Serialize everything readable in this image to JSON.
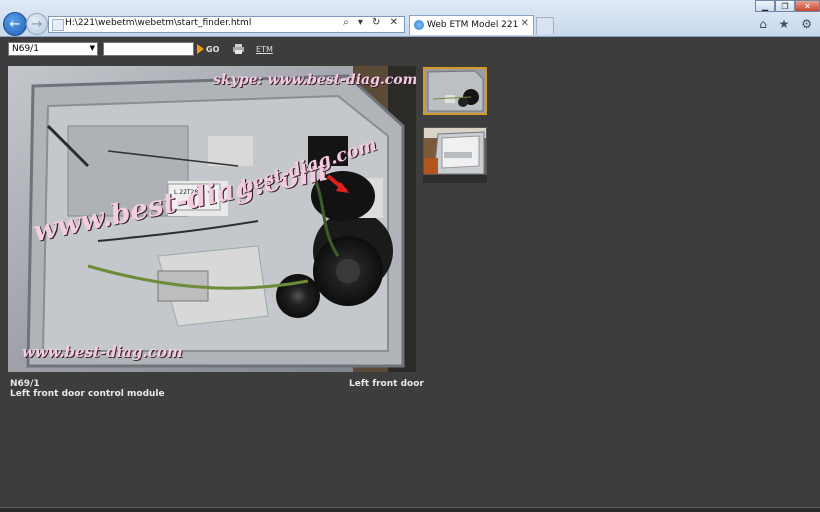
{
  "browser": {
    "address": "H:\\221\\webetm\\webetm\\start_finder.html",
    "tab_title": "Web ETM Model 221",
    "tab_close": "✕",
    "address_tools": "⌕ ▾ ↻ ✕",
    "min": "▁",
    "max": "❐",
    "close": "✕",
    "right_icons": "⌂ ★ ⚙"
  },
  "toolbar": {
    "component_value": "N69/1",
    "search_value": "",
    "go_label": "GO",
    "etm_label": "ETM"
  },
  "photo": {
    "watermark_top": "skype: www.best-diag.com",
    "watermark_center": "www.best-diag.com",
    "watermark_center_small": "best-diag.com",
    "watermark_bottom": "www.best-diag.com",
    "label_text": "L 22T289"
  },
  "caption": {
    "code": "N69/1",
    "description": "Left front door control module",
    "location": "Left front door"
  },
  "colors": {
    "page_bg": "#3d3d3d",
    "thumb_selected_border": "#d49a29",
    "go_arrow": "#f59a16"
  }
}
